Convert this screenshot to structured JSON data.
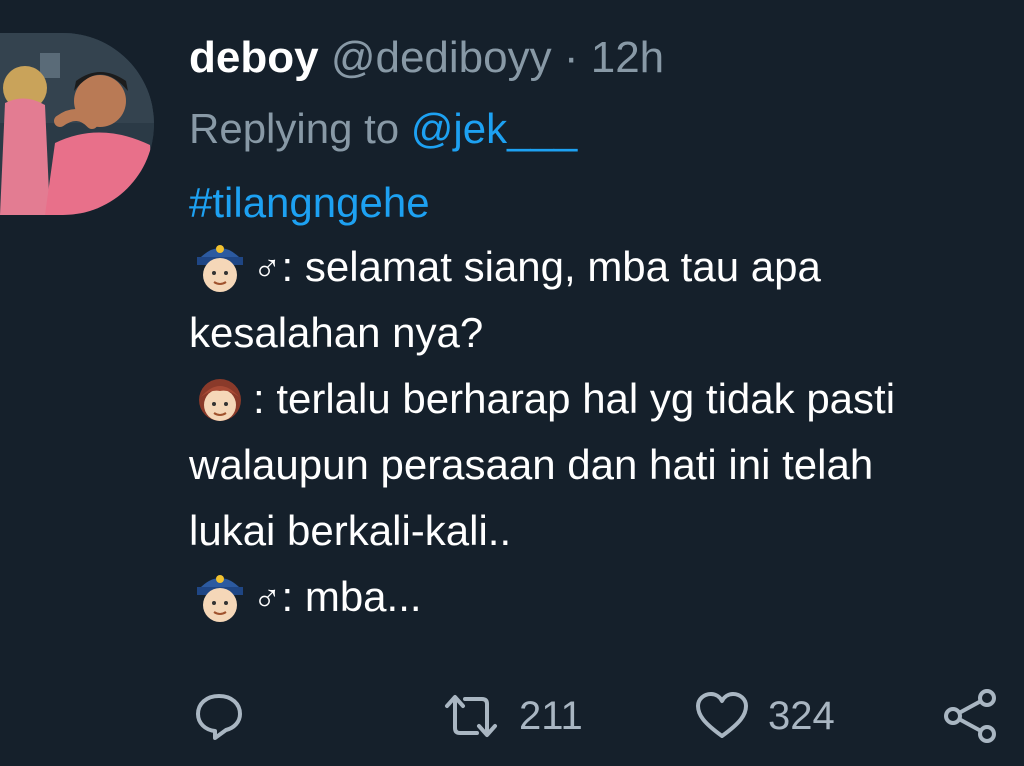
{
  "tweet": {
    "name": "deboy",
    "handle": "@dediboyy",
    "separator": "·",
    "time": "12h",
    "reply_prefix": "Replying to",
    "reply_to": "@jek___",
    "hashtag": "#tilangngehe",
    "lines": [
      {
        "text": ": selamat siang, mba tau apa",
        "speaker": "police-officer",
        "sign": "♂"
      },
      {
        "text": "kesalahan nya?"
      },
      {
        "text": ": terlalu berharap hal yg tidak pasti",
        "speaker": "woman"
      },
      {
        "text": "walaupun perasaan dan hati ini telah"
      },
      {
        "text": "lukai berkali-kali.."
      },
      {
        "text": ": mba...",
        "speaker": "police-officer",
        "sign": "♂"
      }
    ]
  },
  "actions": {
    "reply_icon": "comment-icon",
    "retweet_icon": "retweet-icon",
    "retweet_count": "211",
    "like_icon": "heart-icon",
    "like_count": "324",
    "share_icon": "share-icon"
  },
  "colors": {
    "background": "#15202b",
    "accent": "#1da1f2",
    "muted": "#8899a6"
  }
}
